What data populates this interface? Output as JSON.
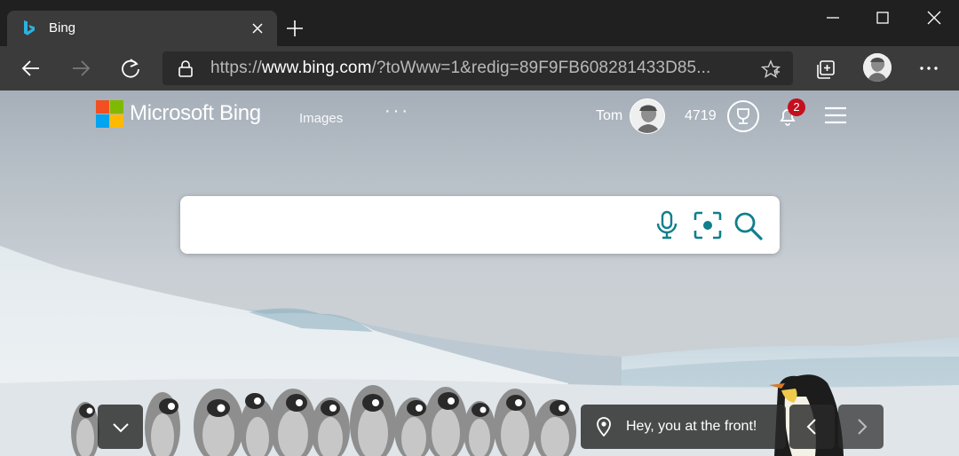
{
  "browser": {
    "tab": {
      "title": "Bing"
    },
    "address": {
      "scheme": "https://",
      "host": "www.bing.com",
      "rest": "/?toWww=1&redig=89F9FB608281433D85..."
    },
    "icons": {
      "favicon": "bing-favicon-icon",
      "tab_close": "close-icon",
      "new_tab": "plus-icon",
      "minimize": "minimize-icon",
      "maximize": "maximize-icon",
      "window_close": "close-icon",
      "back": "arrow-left-icon",
      "forward": "arrow-right-icon",
      "refresh": "refresh-icon",
      "lock": "lock-icon",
      "favorite": "star-icon",
      "collections": "collections-icon",
      "more": "more-icon"
    }
  },
  "bing": {
    "brand": "Microsoft Bing",
    "nav": {
      "images": "Images",
      "more": "···"
    },
    "user": {
      "name": "Tom",
      "points": "4719"
    },
    "notifications": {
      "count": "2"
    },
    "search": {
      "value": "",
      "placeholder": ""
    },
    "caption": "Hey, you at the front!",
    "colors": {
      "accent": "#0f7f8c",
      "badge": "#c50f1f",
      "logo": [
        "#f25022",
        "#7fba00",
        "#00a4ef",
        "#ffb900"
      ]
    }
  }
}
